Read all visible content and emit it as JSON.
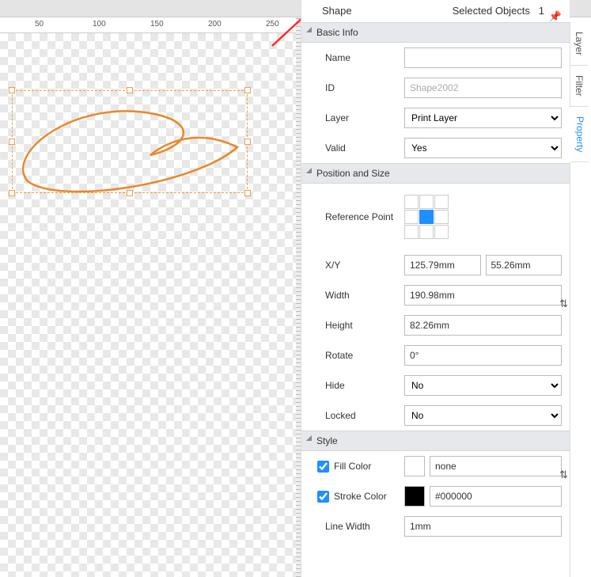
{
  "header": {
    "title": "Shape",
    "selected_label": "Selected Objects",
    "selected_count": "1"
  },
  "ruler": {
    "ticks": [
      "50",
      "100",
      "150",
      "200",
      "250"
    ]
  },
  "sections": {
    "basic": "Basic Info",
    "position": "Position and Size",
    "style": "Style"
  },
  "basic": {
    "name_label": "Name",
    "name_value": "",
    "id_label": "ID",
    "id_value": "Shape2002",
    "layer_label": "Layer",
    "layer_value": "Print Layer",
    "valid_label": "Valid",
    "valid_value": "Yes"
  },
  "pos": {
    "ref_label": "Reference Point",
    "xy_label": "X/Y",
    "x_value": "125.79mm",
    "y_value": "55.26mm",
    "width_label": "Width",
    "width_value": "190.98mm",
    "height_label": "Height",
    "height_value": "82.26mm",
    "rotate_label": "Rotate",
    "rotate_value": "0°",
    "hide_label": "Hide",
    "hide_value": "No",
    "locked_label": "Locked",
    "locked_value": "No"
  },
  "style": {
    "fill_label": "Fill Color",
    "fill_swatch": "#ffffff",
    "fill_value": "none",
    "stroke_label": "Stroke Color",
    "stroke_swatch": "#000000",
    "stroke_value": "#000000",
    "lw_label": "Line Width",
    "lw_value": "1mm"
  },
  "tabs": {
    "layer": "Layer",
    "filter": "Filter",
    "property": "Property"
  }
}
